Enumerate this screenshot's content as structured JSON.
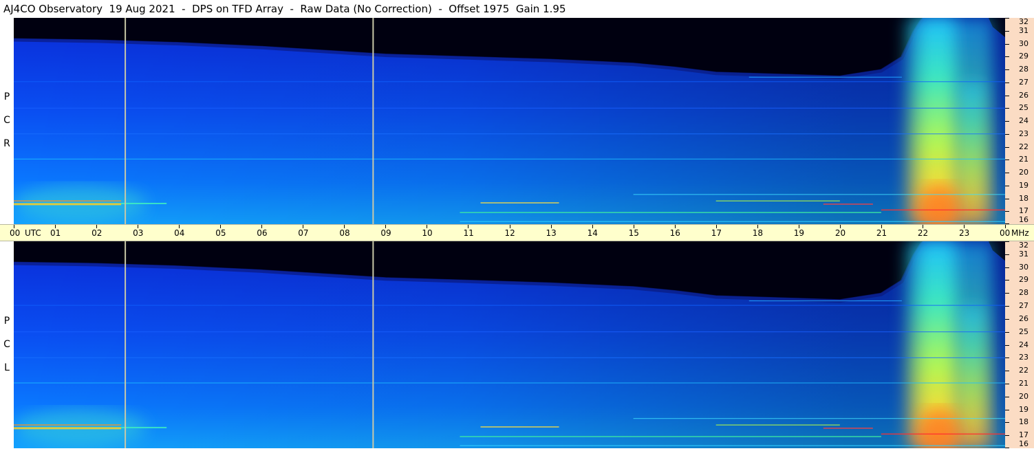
{
  "header": {
    "title": "AJ4CO Observatory  19 Aug 2021  -  DPS on TFD Array  -  Raw Data (No Correction)  -  Offset 1975  Gain 1.95"
  },
  "chart_data": {
    "type": "heatmap",
    "colormap": [
      "#000000",
      "#001a66",
      "#0040ff",
      "#00b0ff",
      "#40ffd0",
      "#c0ff40",
      "#ffff00",
      "#ff8000",
      "#ff0000",
      "#ffffff"
    ],
    "panels": [
      {
        "id": "rcp",
        "label": [
          "R",
          "C",
          "P"
        ]
      },
      {
        "id": "lcp",
        "label": [
          "L",
          "C",
          "P"
        ]
      }
    ],
    "x_axis": {
      "ticks": [
        "00",
        "01",
        "02",
        "03",
        "04",
        "05",
        "06",
        "07",
        "08",
        "09",
        "10",
        "11",
        "12",
        "13",
        "14",
        "15",
        "16",
        "17",
        "18",
        "19",
        "20",
        "21",
        "22",
        "23",
        "00"
      ],
      "unit_label": "UTC",
      "end_unit": "MHz",
      "range_hours": [
        0,
        24
      ]
    },
    "y_axis": {
      "ticks": [
        32,
        31,
        30,
        29,
        28,
        27,
        26,
        25,
        24,
        23,
        22,
        21,
        20,
        19,
        18,
        17,
        16
      ],
      "range_mhz": [
        16,
        32
      ]
    },
    "markers_utc": [
      2.7,
      8.7
    ]
  }
}
